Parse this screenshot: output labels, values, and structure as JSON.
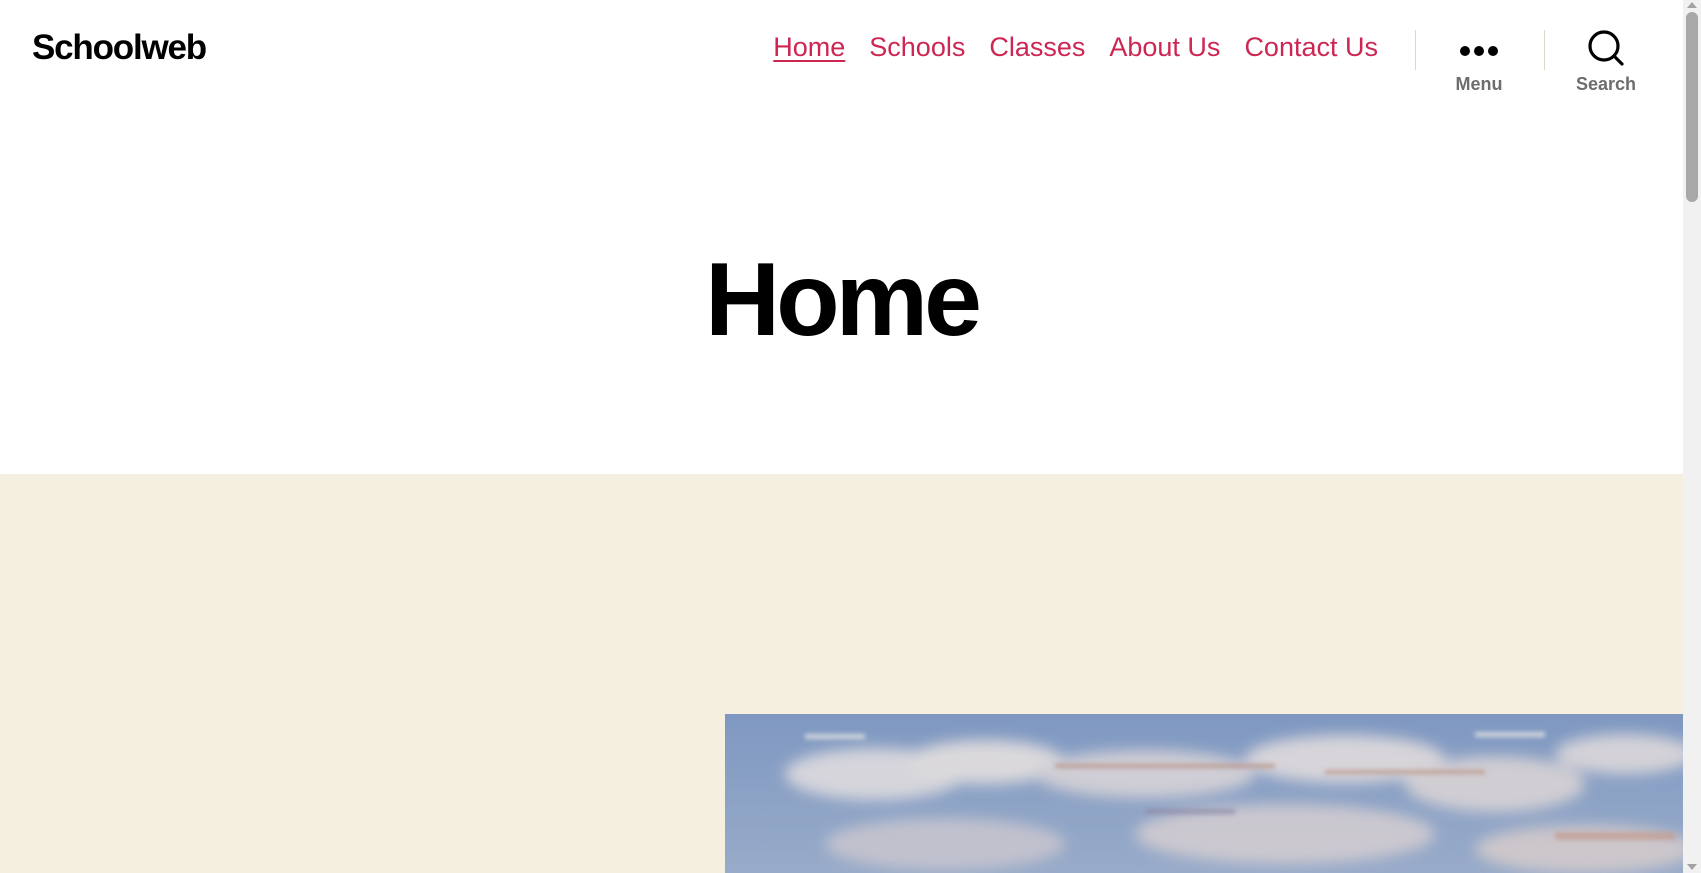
{
  "site": {
    "title": "Schoolweb"
  },
  "nav": {
    "items": [
      {
        "label": "Home"
      },
      {
        "label": "Schools"
      },
      {
        "label": "Classes"
      },
      {
        "label": "About Us"
      },
      {
        "label": "Contact Us"
      }
    ]
  },
  "toggles": {
    "menu": {
      "label": "Menu",
      "icon": "ellipsis-icon"
    },
    "search": {
      "label": "Search",
      "icon": "search-icon"
    }
  },
  "page": {
    "title": "Home"
  },
  "colors": {
    "accent": "#cd2653",
    "cover_background": "#f5efe0",
    "toggle_label": "#6d6d6d"
  },
  "cover_image": {
    "subject": "painting-of-cloudy-sky"
  }
}
